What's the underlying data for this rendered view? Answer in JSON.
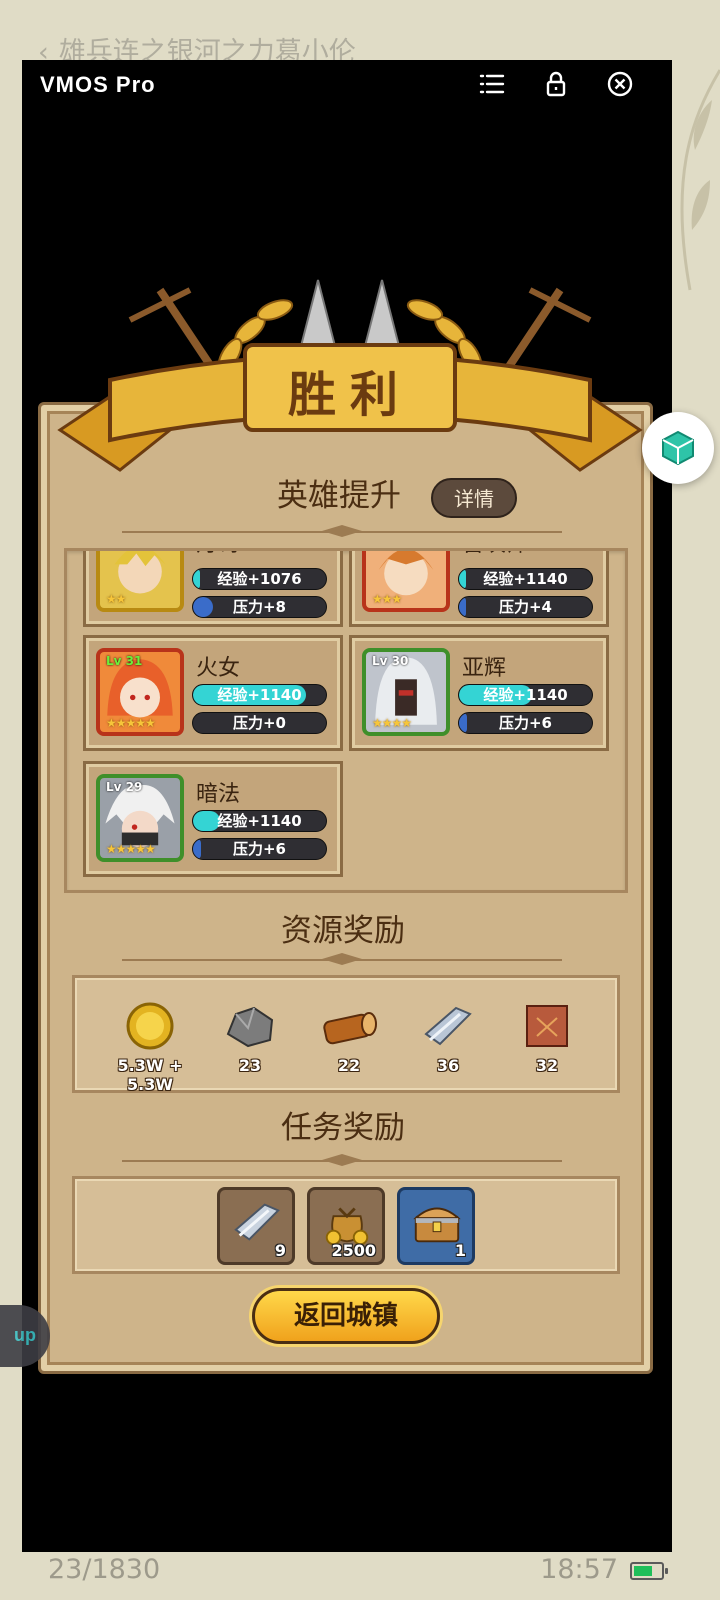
{
  "host": {
    "header_title": "雄兵连之银河之力葛小伦",
    "page_counter": "23/1830",
    "clock": "18:57"
  },
  "vmos": {
    "title": "VMOS  Pro",
    "icons": [
      "menu-icon",
      "lock-icon",
      "close-icon"
    ]
  },
  "game": {
    "banner": "胜利",
    "hero_section": {
      "title": "英雄提升",
      "details_label": "详情",
      "heroes": [
        {
          "name": "灯笥",
          "level": "",
          "exp": "经验+1076",
          "pressure": "压力+8",
          "exp_fill": 0.05,
          "pressure_fill": 0.15,
          "stars": "★★",
          "frame": "gold"
        },
        {
          "name": "召唤师",
          "level": "",
          "exp": "经验+1140",
          "pressure": "压力+4",
          "exp_fill": 0.05,
          "pressure_fill": 0.05,
          "stars": "★★★",
          "frame": "red"
        },
        {
          "name": "火女",
          "level": "Lv 31",
          "exp": "经验+1140",
          "pressure": "压力+0",
          "exp_fill": 0.85,
          "pressure_fill": 0.0,
          "stars": "★★★★★",
          "frame": "red"
        },
        {
          "name": "亚辉",
          "level": "Lv 30",
          "exp": "经验+1140",
          "pressure": "压力+6",
          "exp_fill": 0.55,
          "pressure_fill": 0.06,
          "stars": "★★★★",
          "frame": "green"
        },
        {
          "name": "暗法",
          "level": "Lv 29",
          "exp": "经验+1140",
          "pressure": "压力+6",
          "exp_fill": 0.2,
          "pressure_fill": 0.06,
          "stars": "★★★★★",
          "frame": "green"
        }
      ]
    },
    "resource_section": {
      "title": "资源奖励",
      "items": [
        {
          "icon": "gold-coin-icon",
          "amount": "5.3W + 5.3W"
        },
        {
          "icon": "ore-icon",
          "amount": "23"
        },
        {
          "icon": "wood-log-icon",
          "amount": "22"
        },
        {
          "icon": "steel-bar-icon",
          "amount": "36"
        },
        {
          "icon": "leather-icon",
          "amount": "32"
        }
      ]
    },
    "task_section": {
      "title": "任务奖励",
      "items": [
        {
          "icon": "steel-bar-icon",
          "count": "9"
        },
        {
          "icon": "money-bag-icon",
          "count": "2500"
        },
        {
          "icon": "treasure-chest-icon",
          "count": "1"
        }
      ]
    },
    "return_label": "返回城镇"
  },
  "colors": {
    "exp_fill": "#34d4d4",
    "pressure_fill": "#3a6cc9",
    "panel": "#ceb48a",
    "banner_gold": "#e7b53a"
  }
}
